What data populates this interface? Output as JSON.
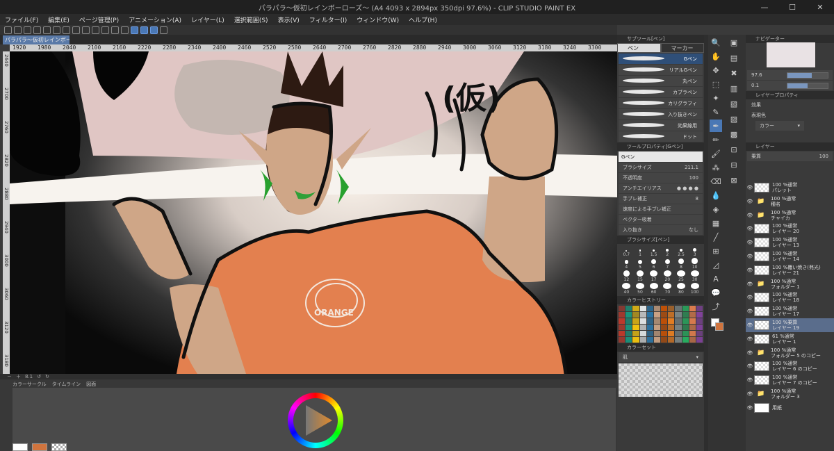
{
  "window": {
    "title": "パラパラ～仮初レインボーローズ～ (A4 4093 x 2894px 350dpi 97.6%) - CLIP STUDIO PAINT EX",
    "minimize": "—",
    "maximize": "☐",
    "close": "✕"
  },
  "menu": [
    "ファイル(F)",
    "編集(E)",
    "ページ管理(P)",
    "アニメーション(A)",
    "レイヤー(L)",
    "選択範囲(S)",
    "表示(V)",
    "フィルター(I)",
    "ウィンドウ(W)",
    "ヘルプ(H)"
  ],
  "document_tab": "パラパラ～仮初レインボーローズ～ ×",
  "ruler_h": [
    "1920",
    "1980",
    "2040",
    "2100",
    "2160",
    "2220",
    "2280",
    "2340",
    "2400",
    "2460",
    "2520",
    "2580",
    "2640",
    "2700",
    "2760",
    "2820",
    "2880",
    "2940",
    "3000",
    "3060",
    "3120",
    "3180",
    "3240",
    "3300"
  ],
  "ruler_v": [
    "2640",
    "2700",
    "2760",
    "2820",
    "2880",
    "2940",
    "3000",
    "3060",
    "3120",
    "3180"
  ],
  "canvas_text": "(仮)",
  "canvas_shirt_text": "ORANGE",
  "status": {
    "zoom": "8.1"
  },
  "bottom_tabs": [
    "カラーサークル",
    "タイムライン",
    "図面"
  ],
  "colors": {
    "main": "#ffffff",
    "sub": "#d0743e",
    "accent": "#4a78b5"
  },
  "sub_tool": {
    "header": "サブツール[ペン]",
    "tabs": [
      "ペン",
      "マーカー"
    ],
    "brushes": [
      "Gペン",
      "リアルGペン",
      "丸ペン",
      "カブラペン",
      "カリグラフィ",
      "入り抜きペン",
      "効果線用",
      "ドット"
    ]
  },
  "tool_property": {
    "header": "ツールプロパティ[Gペン]",
    "name": "Gペン",
    "brush_size_label": "ブラシサイズ",
    "brush_size": "211.1",
    "brush_size_fraction": 0.55,
    "opacity_label": "不透明度",
    "opacity": "100",
    "opacity_fraction": 1.0,
    "antialias_label": "アンチエイリアス",
    "stabilization_label": "手ブレ補正",
    "stabilization": "8",
    "speed_label": "速度による手ブレ補正",
    "vector_label": "ベクター吸着",
    "taper_label": "入り抜き",
    "taper_value": "なし"
  },
  "brush_size_panel": {
    "header": "ブラシサイズ[ペン]",
    "sizes": [
      "0.7",
      "1",
      "1.5",
      "2",
      "2.5",
      "3",
      "4",
      "5",
      "6",
      "7",
      "8",
      "10",
      "12",
      "15",
      "17",
      "20",
      "25",
      "30",
      "40",
      "50",
      "60",
      "70",
      "80",
      "100"
    ]
  },
  "color_history_header": "カラーヒストリー",
  "color_set": {
    "header": "カラーセット",
    "name": "肌"
  },
  "navigator": {
    "header": "ナビゲーター",
    "zoom": "97.6",
    "rotate": "0.1"
  },
  "layer_property": {
    "header": "レイヤープロパティ",
    "effect_label": "効果",
    "expression_label": "表現色",
    "expression_value": "カラー"
  },
  "layer_panel": {
    "header": "レイヤー",
    "blend_mode": "乗算",
    "opacity": "100",
    "layers": [
      {
        "mode": "100 %通常",
        "name": "パレット",
        "type": "raster"
      },
      {
        "mode": "100 %通常",
        "name": "種名",
        "type": "folder"
      },
      {
        "mode": "100 %通常",
        "name": "チャイカ",
        "type": "folder"
      },
      {
        "mode": "100 %通常",
        "name": "レイヤー 20",
        "type": "raster"
      },
      {
        "mode": "100 %通常",
        "name": "レイヤー 13",
        "type": "raster"
      },
      {
        "mode": "100 %通常",
        "name": "レイヤー 14",
        "type": "raster"
      },
      {
        "mode": "100 %覆い焼き(発光)",
        "name": "レイヤー 21",
        "type": "raster"
      },
      {
        "mode": "100 %通常",
        "name": "フォルダー 1",
        "type": "folder"
      },
      {
        "mode": "100 %通常",
        "name": "レイヤー 18",
        "type": "raster"
      },
      {
        "mode": "100 %通常",
        "name": "レイヤー 17",
        "type": "raster"
      },
      {
        "mode": "100 %乗算",
        "name": "レイヤー 19",
        "type": "raster",
        "selected": true
      },
      {
        "mode": "61 %通常",
        "name": "レイヤー 1",
        "type": "raster"
      },
      {
        "mode": "100 %通常",
        "name": "フォルダー 5 のコピー",
        "type": "folder"
      },
      {
        "mode": "100 %通常",
        "name": "レイヤー 6 のコピー",
        "type": "raster"
      },
      {
        "mode": "100 %通常",
        "name": "レイヤー 7 のコピー",
        "type": "raster"
      },
      {
        "mode": "100 %通常",
        "name": "フォルダー 3",
        "type": "folder"
      },
      {
        "mode": "",
        "name": "用紙",
        "type": "paper"
      }
    ]
  }
}
